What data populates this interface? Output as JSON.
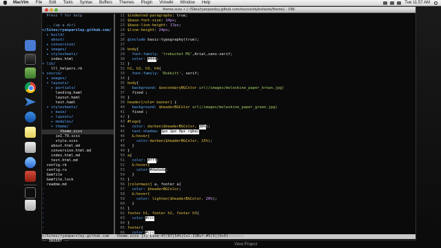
{
  "menubar": {
    "app": "MacVim",
    "items": [
      "File",
      "Edit",
      "Tools",
      "Syntax",
      "Buffers",
      "Themes",
      "Plugin",
      "Vimwiki",
      "Window",
      "Help"
    ],
    "clock": "Tue 11:57 AM"
  },
  "window": {
    "title": "theme.scss + (~/Sites/ryanparsley.github.com/source/stylesheets/theme) - VIM"
  },
  "tree": {
    "help": "  Press ? for help",
    "up": "  .. (up a dir)",
    "root": "</Sites/ryanparsley.github.com/",
    "items": [
      {
        "text": "  ▸ build/",
        "kind": "dir"
      },
      {
        "text": "    about/",
        "kind": "dir"
      },
      {
        "text": "  ▸ conversion/",
        "kind": "dir"
      },
      {
        "text": "  ▸ images/",
        "kind": "dir"
      },
      {
        "text": "  ▸ stylesheets/",
        "kind": "dir"
      },
      {
        "text": "    index.html",
        "kind": "file"
      },
      {
        "text": "▾ lib/",
        "kind": "dir"
      },
      {
        "text": "    lll_helpers.rb",
        "kind": "file"
      },
      {
        "text": "▾ source/",
        "kind": "dir"
      },
      {
        "text": "  ▸ images/",
        "kind": "dir"
      },
      {
        "text": "  ▾ layouts/",
        "kind": "dir"
      },
      {
        "text": "    ▸ partials/",
        "kind": "dir"
      },
      {
        "text": "      landing.haml",
        "kind": "file"
      },
      {
        "text": "      layout.haml",
        "kind": "file"
      },
      {
        "text": "      test.haml",
        "kind": "file"
      },
      {
        "text": "  ▾ stylesheets/",
        "kind": "dir"
      },
      {
        "text": "    ▸ base/",
        "kind": "dir"
      },
      {
        "text": "    ▸ layouts/",
        "kind": "dir"
      },
      {
        "text": "    ▸ modules/",
        "kind": "dir"
      },
      {
        "text": "    ▾ theme/",
        "kind": "dir"
      },
      {
        "text": "        theme.scss",
        "kind": "sel"
      },
      {
        "text": "      ie1.79.scss",
        "kind": "file"
      },
      {
        "text": "      style.scss",
        "kind": "file"
      },
      {
        "text": "    about.html.md",
        "kind": "file"
      },
      {
        "text": "    conversion.html.md",
        "kind": "file"
      },
      {
        "text": "    index.html.md",
        "kind": "file"
      },
      {
        "text": "    test.html.md",
        "kind": "file"
      },
      {
        "text": "  config.rb",
        "kind": "file"
      },
      {
        "text": "  config.ru",
        "kind": "file"
      },
      {
        "text": "  Gemfile",
        "kind": "file"
      },
      {
        "text": "  Gemfile.lock",
        "kind": "file"
      },
      {
        "text": "  readme.md",
        "kind": "file"
      }
    ],
    "tildes": 9
  },
  "editor": {
    "lines": [
      {
        "n": "21",
        "s": [
          [
            "$indented-paragraphs",
            "var"
          ],
          [
            ": true;",
            "plain"
          ]
        ]
      },
      {
        "n": "22",
        "s": [
          [
            "$base-font-size",
            "var"
          ],
          [
            ": ",
            "plain"
          ],
          [
            "14px",
            "num"
          ],
          [
            ";",
            "plain"
          ]
        ]
      },
      {
        "n": "23",
        "s": [
          [
            "$base-line-height",
            "var"
          ],
          [
            ": ",
            "plain"
          ],
          [
            "17px",
            "num"
          ],
          [
            ";",
            "plain"
          ]
        ]
      },
      {
        "n": "24",
        "s": [
          [
            "$line-height",
            "var"
          ],
          [
            ": ",
            "plain"
          ],
          [
            "24px",
            "num"
          ],
          [
            ";",
            "plain"
          ]
        ]
      },
      {
        "n": "25",
        "s": []
      },
      {
        "n": "26",
        "s": [
          [
            "@include",
            "kw"
          ],
          [
            " basic-typography(true);",
            "plain"
          ]
        ]
      },
      {
        "n": "27",
        "s": []
      },
      {
        "n": "28",
        "s": [
          [
            "body",
            "sel"
          ],
          [
            "{",
            "plain"
          ]
        ]
      },
      {
        "n": "29",
        "s": [
          [
            "  font-family: ",
            "kw"
          ],
          [
            "'trebuchet MS'",
            "str"
          ],
          [
            ",Arial,sans-serif;",
            "plain"
          ]
        ]
      },
      {
        "n": "30",
        "s": [
          [
            "  color: ",
            "kw"
          ],
          [
            "#444",
            "hiw"
          ],
          [
            ";",
            "plain"
          ]
        ]
      },
      {
        "n": "31",
        "s": [
          [
            "}",
            "plain"
          ]
        ]
      },
      {
        "n": "32",
        "s": [
          [
            "h1, h2, h3, h4",
            "sel"
          ],
          [
            "{",
            "plain"
          ]
        ]
      },
      {
        "n": "33",
        "s": [
          [
            "  font-family: ",
            "kw"
          ],
          [
            "'Rokkitt'",
            "str"
          ],
          [
            ", serif;",
            "plain"
          ]
        ]
      },
      {
        "n": "34",
        "s": [
          [
            "}",
            "plain"
          ]
        ]
      },
      {
        "n": "35",
        "s": [
          [
            "body",
            "sel"
          ],
          [
            "{",
            "plain"
          ]
        ]
      },
      {
        "n": "36",
        "s": [
          [
            "  background: ",
            "kw"
          ],
          [
            "$secondaryBGColor",
            "var"
          ],
          [
            " url(/images/moleskine_paper_brown.jpg)",
            "str"
          ]
        ]
      },
      {
        "n": "37",
        "s": [
          [
            "  fixed ;",
            "plain"
          ]
        ]
      },
      {
        "n": "38",
        "s": [
          [
            "}",
            "plain"
          ]
        ]
      },
      {
        "n": "39",
        "s": [
          [
            "header[role= banner]",
            "sel"
          ],
          [
            " {",
            "plain"
          ]
        ]
      },
      {
        "n": "40",
        "s": [
          [
            "  background: ",
            "kw"
          ],
          [
            "$headerBGColor",
            "var"
          ],
          [
            " url(/images/moleskine_paper_green.jpg)",
            "str"
          ]
        ]
      },
      {
        "n": "41",
        "s": [
          [
            "  fixed ;",
            "plain"
          ]
        ]
      },
      {
        "n": "42",
        "s": [
          [
            "}",
            "plain"
          ]
        ]
      },
      {
        "n": "43",
        "s": [
          [
            "#logo",
            "sel"
          ],
          [
            "{",
            "plain"
          ]
        ]
      },
      {
        "n": "44",
        "s": [
          [
            "  color: ",
            "kw"
          ],
          [
            "darken($headerBGColor, ",
            "var"
          ],
          [
            "30%",
            "hiw"
          ],
          [
            ");",
            "plain"
          ]
        ]
      },
      {
        "n": "45",
        "s": [
          [
            "  text-shadow: ",
            "kw"
          ],
          [
            "1px 1px 0px rgba(",
            "hiw"
          ]
        ]
      },
      {
        "n": "46",
        "s": [
          [
            "  &:hover{",
            "sel"
          ]
        ]
      },
      {
        "n": "47",
        "s": [
          [
            "    color:",
            "kw"
          ],
          [
            "darken($headerBGColor, 15%)",
            "var"
          ],
          [
            ";",
            "plain"
          ]
        ]
      },
      {
        "n": "48",
        "s": [
          [
            "  }",
            "plain"
          ]
        ]
      },
      {
        "n": "49",
        "s": [
          [
            "}",
            "plain"
          ]
        ]
      },
      {
        "n": "50",
        "s": [
          [
            "a",
            "sel"
          ],
          [
            "{",
            "plain"
          ]
        ]
      },
      {
        "n": "51",
        "s": [
          [
            "  color: ",
            "kw"
          ],
          [
            "#fff",
            "hiw2"
          ],
          [
            ";",
            "plain"
          ]
        ]
      },
      {
        "n": "52",
        "s": [
          [
            "  &:hover{",
            "sel"
          ]
        ]
      },
      {
        "n": "53",
        "s": [
          [
            "    color:",
            "kw"
          ],
          [
            "#dadada",
            "hiw"
          ],
          [
            ";",
            "plain"
          ]
        ]
      },
      {
        "n": "54",
        "s": [
          [
            "  }",
            "plain"
          ]
        ]
      },
      {
        "n": "55",
        "s": [
          [
            "}",
            "plain"
          ]
        ]
      },
      {
        "n": "56",
        "s": [
          [
            "[role=main]",
            "sel"
          ],
          [
            " a, footer a{",
            "plain"
          ]
        ]
      },
      {
        "n": "57",
        "s": [
          [
            "  color: ",
            "kw"
          ],
          [
            "$headerBGColor",
            "var"
          ],
          [
            ";",
            "plain"
          ]
        ]
      },
      {
        "n": "58",
        "s": [
          [
            "  &:hover{",
            "sel"
          ]
        ]
      },
      {
        "n": "59",
        "s": [
          [
            "    color: ",
            "kw"
          ],
          [
            "lighten($headerBGColor, ",
            "var"
          ],
          [
            "20%",
            "num"
          ],
          [
            ");",
            "plain"
          ]
        ]
      },
      {
        "n": "60",
        "s": [
          [
            "  }",
            "plain"
          ]
        ]
      },
      {
        "n": "61",
        "s": [
          [
            "}",
            "plain"
          ]
        ]
      },
      {
        "n": "62",
        "s": [
          [
            "footer h1, footer h2, footer h3",
            "sel"
          ],
          [
            "{",
            "plain"
          ]
        ]
      },
      {
        "n": "63",
        "s": [
          [
            "  color:",
            "kw"
          ],
          [
            "#ccc",
            "hiw2"
          ]
        ]
      },
      {
        "n": "64",
        "s": [
          [
            "}",
            "plain"
          ]
        ]
      },
      {
        "n": "65",
        "s": [
          [
            "footer",
            "sel"
          ],
          [
            "{",
            "plain"
          ]
        ]
      },
      {
        "n": "66",
        "s": [
          [
            "  color:",
            "kw"
          ],
          [
            "#ccc",
            "hiw2"
          ]
        ]
      }
    ]
  },
  "status": {
    "left": "</Sites/ryanparsley.github.com",
    "right": "theme.scss [+] Line:47/87[54%]Col:33Buf:#5[0][0x0]"
  },
  "cmdline": "-- INSERT --",
  "extra": {
    "line1": "Moleskin",
    "line2": "View Project"
  },
  "colors": {
    "background": "#0a0a0a",
    "variable": "#e7c547",
    "keyword": "#5fafff",
    "string": "#a8d06b",
    "number": "#d0a0ff",
    "highlight": "#f2f2f2"
  },
  "dock_icons": [
    "finder-icon",
    "terminal-icon",
    "activity-monitor-icon",
    "chrome-icon",
    "mail-icon",
    "safari-icon",
    "notes-icon",
    "preview-icon",
    "skype-icon",
    "acrobat-icon",
    "folder-icon",
    "trash-icon"
  ]
}
